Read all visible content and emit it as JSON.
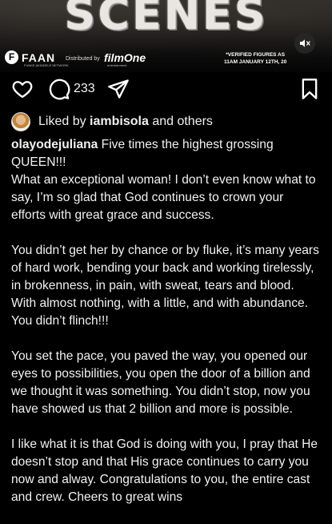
{
  "media": {
    "title": "SCENES",
    "faan_logo": "FAAN",
    "faan_subtext": "FUNKE AKINDELE NETWORK",
    "distributed_by": "Distributed by",
    "filmone_logo": "filmOne",
    "filmone_subtext": "entertainment",
    "verified_line1": "*VERIFIED FIGURES AS",
    "verified_line2": "11AM JANUARY 12TH, 20"
  },
  "actions": {
    "comment_count": "233"
  },
  "likes": {
    "prefix": "Liked by",
    "user": "iambisola",
    "suffix": "and others"
  },
  "caption": {
    "username": "olayodejuliana",
    "first_line": "Five times the highest grossing QUEEN!!!",
    "paragraph1": "What an exceptional woman! I don’t even know what to say, I’m so glad that God continues to crown your efforts with great grace and success.",
    "paragraph2": "You didn’t get her by chance or by fluke, it’s many years of hard work, bending your back and working tirelessly, in brokenness, in pain, with sweat, tears and blood. With almost nothing, with a little, and with abundance. You didn’t flinch!!!",
    "paragraph3": "You set the pace, you paved the way, you opened our eyes to possibilities, you open the door of a billion and we thought it was something. You didn’t stop, now you have showed us that 2 billion and more is possible.",
    "paragraph4": "I like what it is that God is doing with you, I pray that He doesn’t stop and that His grace continues to carry you now and alway. Congratulations to you, the entire cast and crew. Cheers to great wins"
  },
  "icons": {
    "mute": "speaker-muted-icon",
    "like": "heart-icon",
    "comment": "comment-bubble-icon",
    "share": "paper-plane-icon",
    "save": "bookmark-icon"
  }
}
